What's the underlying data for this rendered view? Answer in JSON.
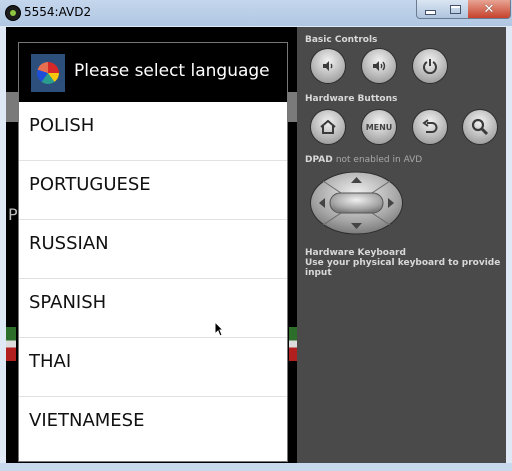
{
  "window": {
    "title": "5554:AVD2"
  },
  "dialog": {
    "title": "Please select language",
    "languages": [
      "POLISH",
      "PORTUGUESE",
      "RUSSIAN",
      "SPANISH",
      "THAI",
      "VIETNAMESE"
    ]
  },
  "background": {
    "partial_letter": "P"
  },
  "panel": {
    "basic_controls_label": "Basic Controls",
    "hardware_buttons_label": "Hardware Buttons",
    "menu_label": "MENU",
    "dpad_label": "DPAD",
    "dpad_note": "not enabled in AVD",
    "keyboard_label": "Hardware Keyboard",
    "keyboard_hint": "Use your physical keyboard to provide input"
  },
  "icons": [
    "app-icon",
    "globe-icon",
    "volume-down-icon",
    "volume-up-icon",
    "power-icon",
    "home-icon",
    "back-icon",
    "search-icon",
    "dpad-icon",
    "cursor-icon"
  ]
}
